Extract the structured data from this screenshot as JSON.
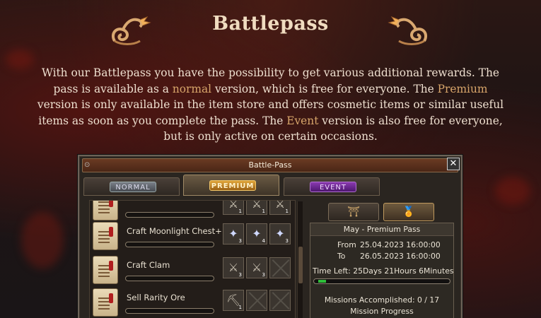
{
  "page": {
    "title": "Battlepass",
    "intro_parts": [
      {
        "text": "With our Battlepass you have the possibility to get various additional rewards. The pass is available as a ",
        "hl": false
      },
      {
        "text": "normal",
        "hl": true
      },
      {
        "text": " version, which is free for everyone. The ",
        "hl": false
      },
      {
        "text": "Premium",
        "hl": true
      },
      {
        "text": " version is only available in the item store and offers cosmetic items or similar useful items as soon as you complete the pass. The ",
        "hl": false
      },
      {
        "text": "Event",
        "hl": true
      },
      {
        "text": " version is also free for everyone, but is only active on certain occasions.",
        "hl": false
      }
    ]
  },
  "window": {
    "title": "Battle-Pass",
    "close": "✕",
    "tabs": [
      "NORMAL",
      "PREMIUM",
      "EVENT"
    ],
    "active_tab": 1,
    "missions": [
      {
        "name": "",
        "rewards": [
          {
            "icon": "⚔",
            "qty": "1"
          },
          {
            "icon": "⚔",
            "qty": "1"
          },
          {
            "icon": "⚔",
            "qty": "1"
          }
        ]
      },
      {
        "name": "Craft Moonlight Chest+",
        "rewards": [
          {
            "icon": "✦",
            "qty": "3"
          },
          {
            "icon": "✦",
            "qty": "4"
          },
          {
            "icon": "✦",
            "qty": "3"
          }
        ]
      },
      {
        "name": "Craft Clam",
        "rewards": [
          {
            "icon": "⚔",
            "qty": "3"
          },
          {
            "icon": "⚔",
            "qty": "3"
          },
          {
            "icon": "",
            "qty": ""
          }
        ]
      },
      {
        "name": "Sell Rarity Ore",
        "rewards": [
          {
            "icon": "⛏",
            "qty": "1"
          },
          {
            "icon": "",
            "qty": ""
          },
          {
            "icon": "",
            "qty": ""
          }
        ]
      }
    ],
    "info": {
      "title": "May - Premium Pass",
      "from_label": "From",
      "from_value": "25.04.2023 16:00:00",
      "to_label": "To",
      "to_value": "26.05.2023 16:00:00",
      "time_left": "Time Left: 25Days 21Hours 6Minutes",
      "progress": 0.06,
      "missions_accomplished": "Missions Accomplished: 0 / 17",
      "mission_progress": "Mission Progress"
    },
    "colors": {
      "accent": "#d7a56a",
      "premium": "#e0a53a",
      "event": "#8a3ab0",
      "progress": "#2fbf3a"
    }
  }
}
